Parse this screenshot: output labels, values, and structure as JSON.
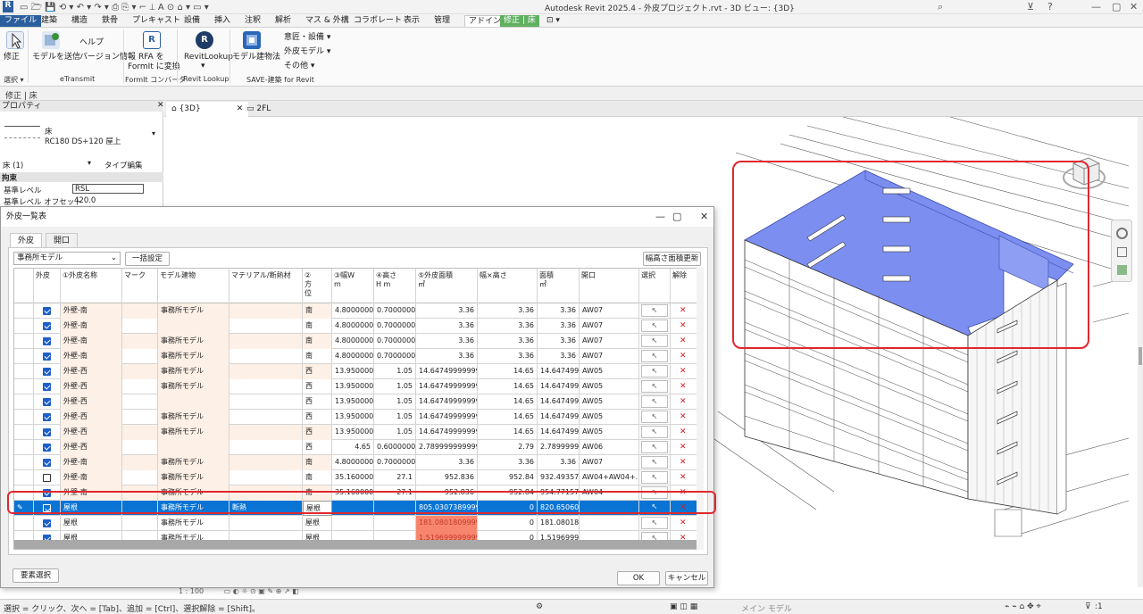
{
  "app": {
    "title": "Autodesk Revit 2025.4 - 外皮プロジェクト.rvt - 3D ビュー: {3D}"
  },
  "ribbon_tabs": [
    "ファイル",
    "建築",
    "構造",
    "鉄骨",
    "プレキャスト",
    "設備",
    "挿入",
    "注釈",
    "解析",
    "マス & 外構",
    "コラボレート",
    "表示",
    "管理",
    "アドイン",
    "修正 | 床"
  ],
  "ribbon": {
    "modify": "修正",
    "select": "選択 ▾",
    "send_model": "モデルを送信",
    "help": "ヘルプ",
    "version": "バージョン情報",
    "etransmit": "eTransmit",
    "rfa_line1": "RFA を",
    "rfa_line2": "FormIt に変換",
    "formit": "FormIt コンバータ",
    "revitlookup": "RevitLookup",
    "revitlookup_group": "Revit Lookup",
    "model_build": "モデル建物法",
    "save_group": "SAVE-建築 for Revit",
    "dd1": "意匠・設備 ▾",
    "dd2": "外皮モデル ▾",
    "dd3": "その他 ▾"
  },
  "options_bar": "修正 | 床",
  "properties": {
    "header": "プロパティ",
    "type_line1": "床",
    "type_line2": "RC180 DS+120 屋上",
    "filter": "床 (1)",
    "edit_type": "タイプ編集",
    "section": "拘束",
    "p1_label": "基準レベル",
    "p1_value": "RSL",
    "p2_label": "基準レベル オフセット",
    "p2_value": "420.0"
  },
  "view_tabs": [
    "{3D}",
    "2FL"
  ],
  "dialog": {
    "title": "外皮一覧表",
    "tabs": [
      "外皮",
      "開口"
    ],
    "model_select": "事務所モデル",
    "bulk_btn": "一括設定",
    "recalc_btn": "幅高さ面積更新",
    "select_elem_btn": "要素選択",
    "ok_btn": "OK",
    "cancel_btn": "キャンセル",
    "columns": [
      "外皮",
      "①外皮名称",
      "マーク",
      "モデル建物",
      "マテリアル/断熱材",
      "②\n方\n位",
      "③幅W\nm",
      "④高さ\nH m",
      "⑤外皮面積\n㎡",
      "幅×高さ",
      "面積\n㎡",
      "開口",
      "選択",
      "解除"
    ],
    "rows": [
      {
        "chk": true,
        "name": "外壁-南",
        "mark": "",
        "model": "事務所モデル",
        "mat": "",
        "dir": "南",
        "w": "4.8000000...",
        "h": "0.7000000...",
        "area": "3.36",
        "wh": "3.36",
        "a2": "3.36",
        "open": "AW07",
        "state": "norm"
      },
      {
        "chk": true,
        "name": "外壁-南",
        "mark": "",
        "model": "",
        "mat": "",
        "dir": "南",
        "w": "4.8000000...",
        "h": "0.7000000...",
        "area": "3.36",
        "wh": "3.36",
        "a2": "3.36",
        "open": "AW07",
        "state": "norm"
      },
      {
        "chk": true,
        "name": "外壁-南",
        "mark": "",
        "model": "事務所モデル",
        "mat": "",
        "dir": "南",
        "w": "4.8000000...",
        "h": "0.7000000...",
        "area": "3.36",
        "wh": "3.36",
        "a2": "3.36",
        "open": "AW07",
        "state": "norm"
      },
      {
        "chk": true,
        "name": "外壁-南",
        "mark": "",
        "model": "事務所モデル",
        "mat": "",
        "dir": "南",
        "w": "4.8000000...",
        "h": "0.7000000...",
        "area": "3.36",
        "wh": "3.36",
        "a2": "3.36",
        "open": "AW07",
        "state": "norm"
      },
      {
        "chk": true,
        "name": "外壁-西",
        "mark": "",
        "model": "事務所モデル",
        "mat": "",
        "dir": "西",
        "w": "13.950000...",
        "h": "1.05",
        "area": "14.64749999999...",
        "wh": "14.65",
        "a2": "14.647499...",
        "open": "AW05",
        "state": "norm"
      },
      {
        "chk": true,
        "name": "外壁-西",
        "mark": "",
        "model": "事務所モデル",
        "mat": "",
        "dir": "西",
        "w": "13.950000...",
        "h": "1.05",
        "area": "14.64749999999...",
        "wh": "14.65",
        "a2": "14.647499...",
        "open": "AW05",
        "state": "norm"
      },
      {
        "chk": true,
        "name": "外壁-西",
        "mark": "",
        "model": "",
        "mat": "",
        "dir": "西",
        "w": "13.950000...",
        "h": "1.05",
        "area": "14.64749999999...",
        "wh": "14.65",
        "a2": "14.647499...",
        "open": "AW05",
        "state": "norm"
      },
      {
        "chk": true,
        "name": "外壁-西",
        "mark": "",
        "model": "事務所モデル",
        "mat": "",
        "dir": "西",
        "w": "13.950000...",
        "h": "1.05",
        "area": "14.64749999999...",
        "wh": "14.65",
        "a2": "14.647499...",
        "open": "AW05",
        "state": "norm"
      },
      {
        "chk": true,
        "name": "外壁-西",
        "mark": "",
        "model": "事務所モデル",
        "mat": "",
        "dir": "西",
        "w": "13.950000...",
        "h": "1.05",
        "area": "14.64749999999...",
        "wh": "14.65",
        "a2": "14.647499...",
        "open": "AW05",
        "state": "norm"
      },
      {
        "chk": true,
        "name": "外壁-西",
        "mark": "",
        "model": "",
        "mat": "",
        "dir": "西",
        "w": "4.65",
        "h": "0.6000000...",
        "area": "2.789999999999...",
        "wh": "2.79",
        "a2": "2.7899999...",
        "open": "AW06",
        "state": "norm"
      },
      {
        "chk": true,
        "name": "外壁-南",
        "mark": "",
        "model": "事務所モデル",
        "mat": "",
        "dir": "南",
        "w": "4.8000000...",
        "h": "0.7000000...",
        "area": "3.36",
        "wh": "3.36",
        "a2": "3.36",
        "open": "AW07",
        "state": "norm"
      },
      {
        "chk": false,
        "name": "外壁-南",
        "mark": "",
        "model": "事務所モデル",
        "mat": "",
        "dir": "南",
        "w": "35.160000...",
        "h": "27.1",
        "area": "952.836",
        "wh": "952.84",
        "a2": "932.49357",
        "open": "AW04+AW04+...",
        "state": "norm"
      },
      {
        "chk": true,
        "name": "外壁-南",
        "mark": "",
        "model": "事務所モデル",
        "mat": "",
        "dir": "南",
        "w": "35.160000...",
        "h": "27.1",
        "area": "952.836",
        "wh": "952.84",
        "a2": "954.771574",
        "open": "AW04",
        "state": "norm"
      },
      {
        "chk": true,
        "name": "屋根",
        "mark": "",
        "model": "事務所モデル",
        "mat": "断熱",
        "dir": "屋根",
        "w": "",
        "h": "",
        "area": "805.0307389999...",
        "wh": "0",
        "a2": "820.65060...",
        "open": "",
        "state": "selected"
      },
      {
        "chk": true,
        "name": "屋根",
        "mark": "",
        "model": "事務所モデル",
        "mat": "",
        "dir": "屋根",
        "w": "",
        "h": "",
        "area": "181.0801809999...",
        "wh": "0",
        "a2": "181.08018...",
        "open": "",
        "state": "warn"
      },
      {
        "chk": true,
        "name": "屋根",
        "mark": "",
        "model": "事務所モデル",
        "mat": "",
        "dir": "屋根",
        "w": "",
        "h": "",
        "area": "1.519699999999...",
        "wh": "0",
        "a2": "1.5196999...",
        "open": "",
        "state": "warn"
      }
    ]
  },
  "view_bar": "1 : 100",
  "status": {
    "hint": "選択 = クリック、次へ = [Tab]、追加 = [Ctrl]、選択解除 = [Shift]。",
    "model": "メイン モデル",
    "filter_count": ":1"
  },
  "colors": {
    "accent": "#1e5ec8",
    "selected_row": "#0a74d4",
    "warn_cell": "#f8866e",
    "row_tint": "#fdf0e6",
    "roof_blue": "#7c8ff0",
    "highlight": "#e0282e"
  }
}
